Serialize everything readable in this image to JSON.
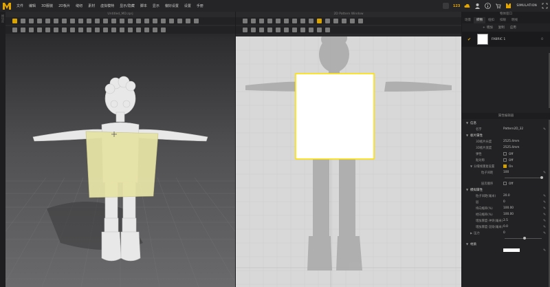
{
  "menubar": {
    "items": [
      "文件",
      "编辑",
      "3D服装",
      "2D板片",
      "缝纫",
      "素材",
      "虚拟模特",
      "显示/隐藏",
      "脚本",
      "显示",
      "偏好设置",
      "设置",
      "手册"
    ],
    "points": "123",
    "simulation_label": "SIMULATION",
    "colors": {
      "accent": "#e3a600"
    }
  },
  "view3d": {
    "title": "Untitled_MD.zprj"
  },
  "view2d": {
    "title": "2D Pattern Window"
  },
  "left_strip": {
    "label": "模块库"
  },
  "right_panel": {
    "title": "物体窗口",
    "tabs": [
      "场景",
      "织物",
      "纽扣",
      "扣眼",
      "明线"
    ],
    "active_tab": 1,
    "actions": {
      "add": "增加",
      "copy": "复制",
      "apply": "应用"
    },
    "fabric": {
      "name": "FABRIC 1",
      "count": "0"
    },
    "property_title": "属性编辑器",
    "sections": {
      "info": {
        "title": "信息",
        "name_label": "名字",
        "name_value": "Pattern2D_32"
      },
      "pattern": {
        "title": "板片属性",
        "width_label": "3D板片长度",
        "width_value": "2525.4mm",
        "height_label": "3D板片宽度",
        "height_value": "2525.4mm",
        "elastic_label": "弹性",
        "elastic_value": "Off",
        "symmetry_label": "贴对称",
        "symmetry_value": "Off",
        "sim_label": "分缝线重复设置",
        "sim_value": "On",
        "density_label": "粒子间距",
        "density_value": "100",
        "fold_label": "层次顺序",
        "fold_value": "Off"
      },
      "sim_props": {
        "title": "模拟属性",
        "p1_label": "粒子间距(毫米)",
        "p1_value": "20.0",
        "p2_label": "层",
        "p2_value": "0",
        "p3_label": "纬向缩率(%)",
        "p3_value": "100.00",
        "p4_label": "经向缩率(%)",
        "p4_value": "100.00",
        "p5_label": "增加厚度-冲突(毫米)",
        "p5_value": "2.5",
        "p6_label": "增加厚度-渲染(毫米)",
        "p6_value": "0.0",
        "p7_label": "压力",
        "p7_value": "0"
      },
      "material": {
        "title": "材质"
      }
    }
  }
}
